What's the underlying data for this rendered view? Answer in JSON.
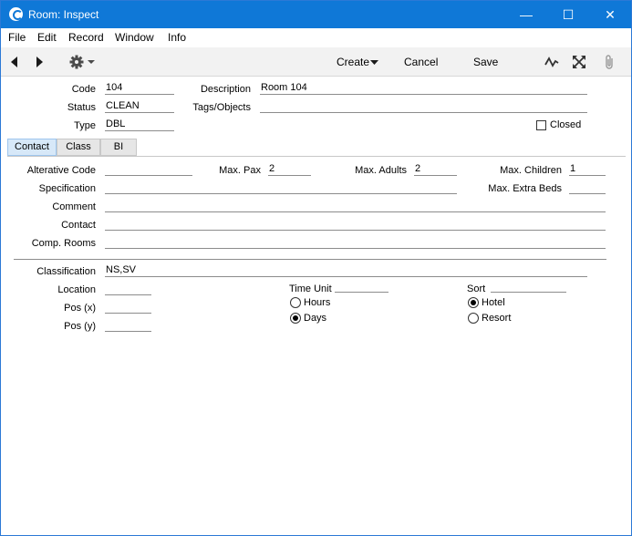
{
  "window": {
    "title": "Room: Inspect",
    "minimize_symbol": "—",
    "maximize_symbol": "☐",
    "close_symbol": "✕"
  },
  "menu": [
    "File",
    "Edit",
    "Record",
    "Window",
    "Info"
  ],
  "toolbar": {
    "back_icon": "triangle-left-icon",
    "forward_icon": "triangle-right-icon",
    "gear_icon": "gear-icon",
    "create_label": "Create",
    "cancel_label": "Cancel",
    "save_label": "Save",
    "activity_icon": "pulse-icon",
    "expand_icon": "expand-icon",
    "attach_icon": "paperclip-icon"
  },
  "header": {
    "code_label": "Code",
    "code_value": "104",
    "status_label": "Status",
    "status_value": "CLEAN",
    "type_label": "Type",
    "type_value": "DBL",
    "description_label": "Description",
    "description_value": "Room 104",
    "tags_label": "Tags/Objects",
    "tags_value": "",
    "closed_label": "Closed",
    "closed_checked": false
  },
  "tabs": [
    {
      "label": "Contact",
      "active": true
    },
    {
      "label": "Class",
      "active": false
    },
    {
      "label": "BI",
      "active": false
    }
  ],
  "contact": {
    "alt_code_label": "Alterative Code",
    "alt_code_value": "",
    "max_pax_label": "Max. Pax",
    "max_pax_value": "2",
    "max_adults_label": "Max. Adults",
    "max_adults_value": "2",
    "max_children_label": "Max. Children",
    "max_children_value": "1",
    "specification_label": "Specification",
    "specification_value": "",
    "max_extra_beds_label": "Max. Extra Beds",
    "max_extra_beds_value": "",
    "comment_label": "Comment",
    "comment_value": "",
    "contact_label": "Contact",
    "contact_value": "",
    "comp_rooms_label": "Comp. Rooms",
    "comp_rooms_value": ""
  },
  "classification": {
    "classification_label": "Classification",
    "classification_value": "NS,SV",
    "location_label": "Location",
    "location_value": "",
    "pos_x_label": "Pos (x)",
    "pos_x_value": "",
    "pos_y_label": "Pos (y)",
    "pos_y_value": "",
    "time_unit_label": "Time Unit",
    "time_unit_options": [
      "Hours",
      "Days"
    ],
    "time_unit_selected": "Days",
    "sort_label": "Sort",
    "sort_options": [
      "Hotel",
      "Resort"
    ],
    "sort_selected": "Hotel"
  }
}
